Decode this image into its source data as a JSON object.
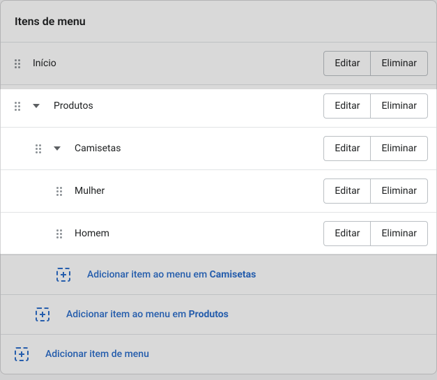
{
  "header": {
    "title": "Itens de menu"
  },
  "buttons": {
    "edit": "Editar",
    "delete": "Eliminar"
  },
  "items": [
    {
      "label": "Início",
      "indent": 0,
      "hasChildren": false
    },
    {
      "label": "Produtos",
      "indent": 0,
      "hasChildren": true
    },
    {
      "label": "Camisetas",
      "indent": 1,
      "hasChildren": true
    },
    {
      "label": "Mulher",
      "indent": 2,
      "hasChildren": false
    },
    {
      "label": "Homem",
      "indent": 2,
      "hasChildren": false
    }
  ],
  "addActions": {
    "prefix": "Adicionar item ao menu em ",
    "targets": [
      "Camisetas",
      "Produtos"
    ],
    "root": "Adicionar item de menu"
  }
}
